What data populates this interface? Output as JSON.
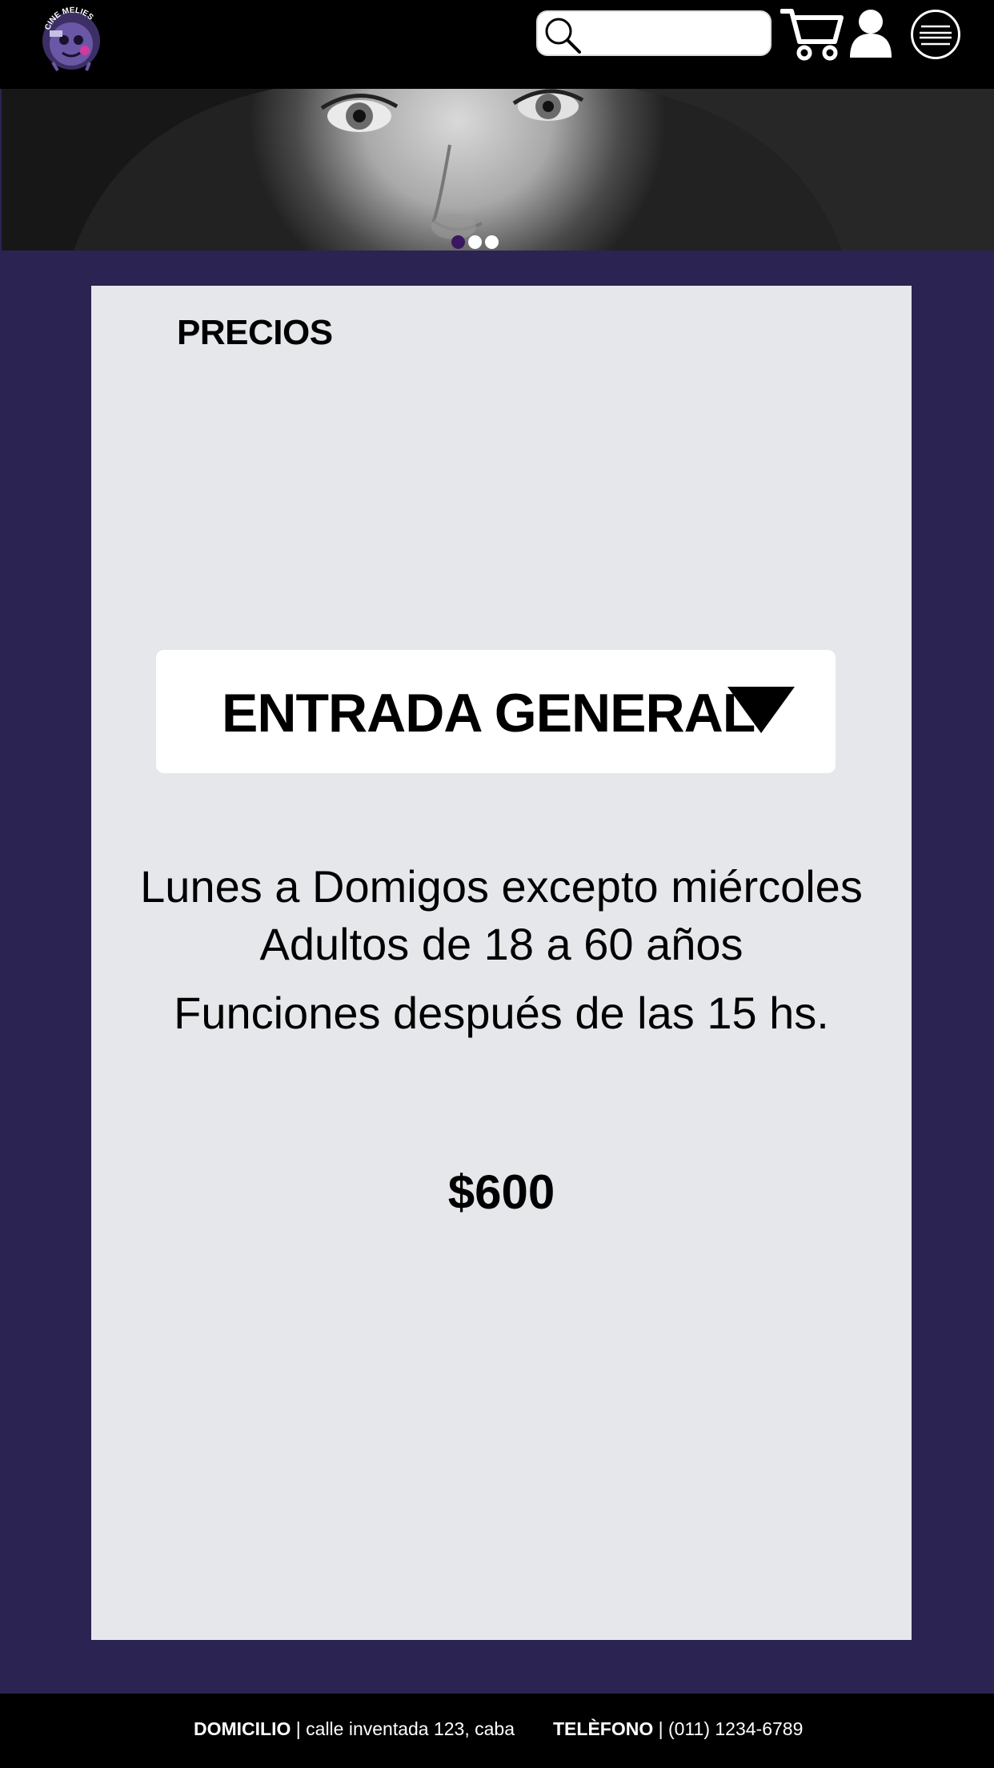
{
  "brand": {
    "logo_text": "CINE MELIES"
  },
  "header": {
    "search": {
      "placeholder": "",
      "icon": "search-icon"
    },
    "cart_icon": "cart-icon",
    "user_icon": "user-icon",
    "menu_icon": "hamburger-menu-icon"
  },
  "hero": {
    "slides": 3,
    "active_slide": 1
  },
  "main": {
    "title": "PRECIOS",
    "ticket_select": {
      "selected": "ENTRADA GENERAL"
    },
    "description": [
      "Lunes a Domigos excepto miércoles",
      "Adultos de 18 a 60 años",
      "Funciones después de las 15 hs."
    ],
    "price": "$600"
  },
  "footer": {
    "address_label": "DOMICILIO",
    "address_value": "| calle inventada 123, caba",
    "phone_label": "TELÈFONO",
    "phone_value": "| (011) 1234-6789"
  },
  "colors": {
    "background": "#2b2352",
    "header": "#000000",
    "card": "#e6e7eb",
    "active_dot": "#3a1760"
  }
}
